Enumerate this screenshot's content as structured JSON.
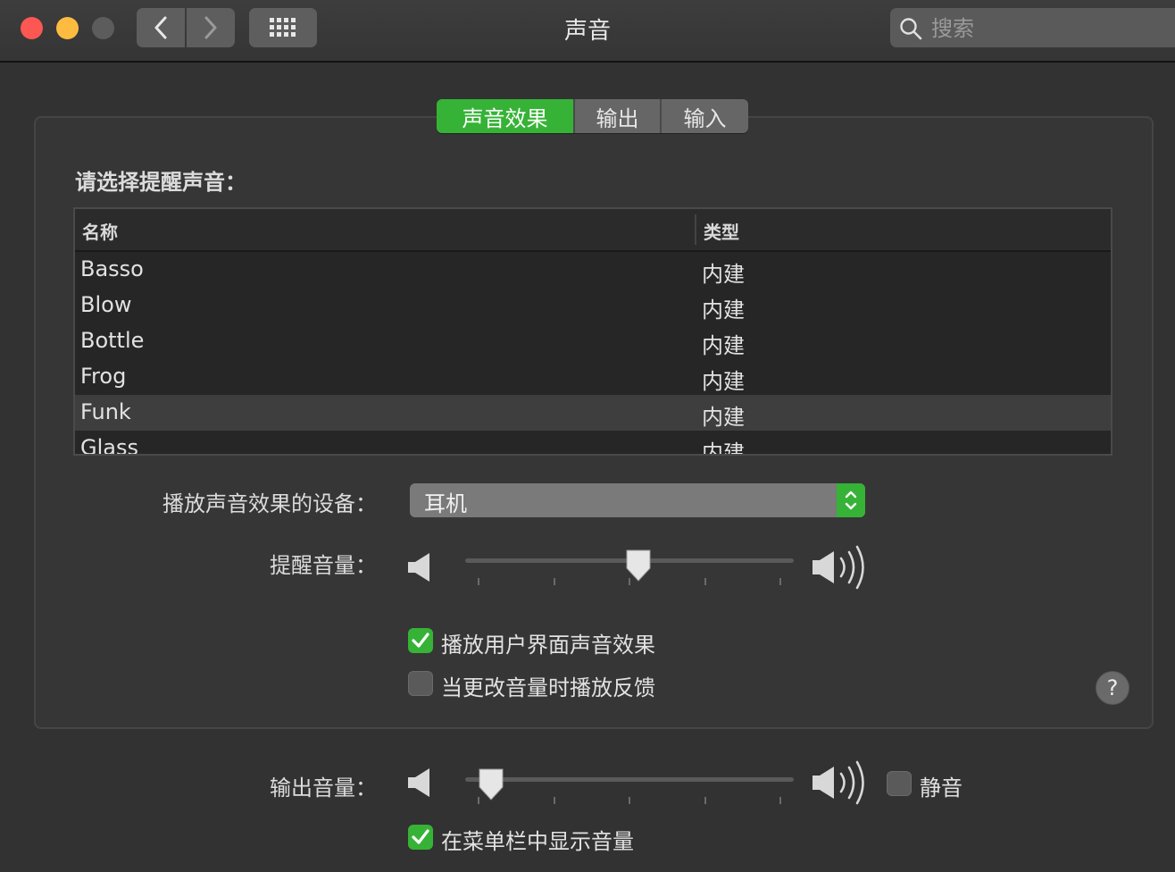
{
  "window": {
    "title": "声音",
    "search_placeholder": "搜索"
  },
  "tabs": [
    {
      "label": "声音效果",
      "active": true
    },
    {
      "label": "输出",
      "active": false
    },
    {
      "label": "输入",
      "active": false
    }
  ],
  "alerts": {
    "section_label": "请选择提醒声音：",
    "columns": {
      "name": "名称",
      "type": "类型"
    },
    "rows": [
      {
        "name": "Basso",
        "type": "内建"
      },
      {
        "name": "Blow",
        "type": "内建"
      },
      {
        "name": "Bottle",
        "type": "内建"
      },
      {
        "name": "Frog",
        "type": "内建"
      },
      {
        "name": "Funk",
        "type": "内建",
        "selected": true
      },
      {
        "name": "Glass",
        "type": "内建"
      }
    ]
  },
  "device": {
    "label": "播放声音效果的设备：",
    "value": "耳机"
  },
  "alert_volume": {
    "label": "提醒音量：",
    "level": 0.53
  },
  "checkboxes": {
    "ui_sounds": {
      "label": "播放用户界面声音效果",
      "checked": true
    },
    "feedback": {
      "label": "当更改音量时播放反馈",
      "checked": false
    }
  },
  "help": {
    "label": "?"
  },
  "output_volume": {
    "label": "输出音量：",
    "level": 0.04,
    "mute_label": "静音",
    "mute_checked": false
  },
  "menubar_volume": {
    "label": "在菜单栏中显示音量",
    "checked": true
  },
  "colors": {
    "accent": "#36b336",
    "close": "#fc5753",
    "minimize": "#fdbc40"
  }
}
